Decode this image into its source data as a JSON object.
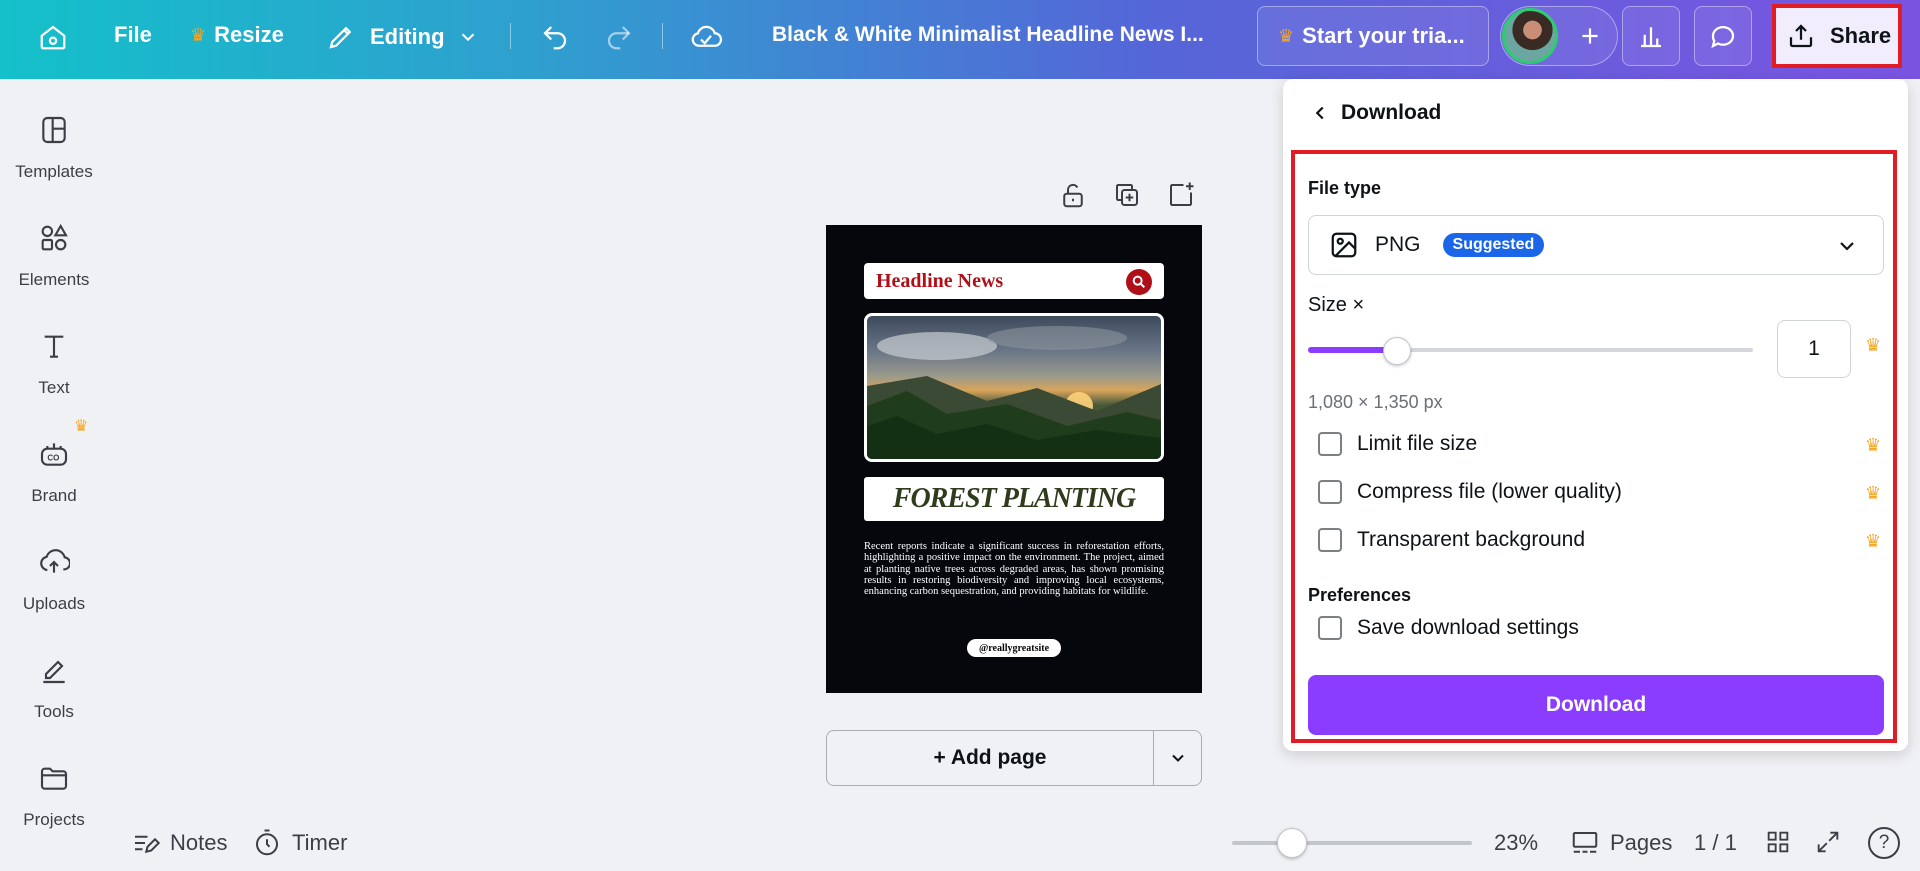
{
  "topbar": {
    "file_label": "File",
    "resize_label": "Resize",
    "editing_label": "Editing",
    "doc_title": "Black & White Minimalist Headline News I...",
    "trial_label": "Start your tria...",
    "share_label": "Share"
  },
  "sidebar": {
    "items": [
      {
        "label": "Templates",
        "icon": "templates-icon"
      },
      {
        "label": "Elements",
        "icon": "elements-icon"
      },
      {
        "label": "Text",
        "icon": "text-icon"
      },
      {
        "label": "Brand",
        "icon": "brand-icon"
      },
      {
        "label": "Uploads",
        "icon": "uploads-icon"
      },
      {
        "label": "Tools",
        "icon": "tools-icon"
      },
      {
        "label": "Projects",
        "icon": "projects-icon"
      }
    ]
  },
  "design": {
    "header": "Headline News",
    "title": "FOREST PLANTING",
    "body": "Recent reports indicate a significant success in reforestation efforts, highlighting a positive impact on the environment. The project, aimed at planting native trees across degraded areas, has shown promising results in restoring biodiversity and improving local ecosystems, enhancing carbon sequestration, and providing habitats for wildlife.",
    "handle": "@reallygreatsite"
  },
  "add_page_label": "+ Add page",
  "download_panel": {
    "title": "Download",
    "file_type_label": "File type",
    "file_type_value": "PNG",
    "suggested_badge": "Suggested",
    "size_label": "Size ×",
    "size_value": "1",
    "size_fraction": 0.2,
    "dimensions": "1,080 × 1,350 px",
    "options": [
      {
        "label": "Limit file size",
        "checked": false
      },
      {
        "label": "Compress file (lower quality)",
        "checked": false
      },
      {
        "label": "Transparent background",
        "checked": false
      }
    ],
    "preferences_label": "Preferences",
    "save_settings_label": "Save download settings",
    "download_button": "Download"
  },
  "bottombar": {
    "notes_label": "Notes",
    "timer_label": "Timer",
    "zoom_value": "23%",
    "zoom_fraction": 0.25,
    "pages_label": "Pages",
    "page_count": "1 / 1",
    "help_label": "?"
  },
  "colors": {
    "accent": "#8b3dff",
    "highlight": "#e11c24",
    "badge": "#1a66e9",
    "crown": "#f5a623"
  }
}
